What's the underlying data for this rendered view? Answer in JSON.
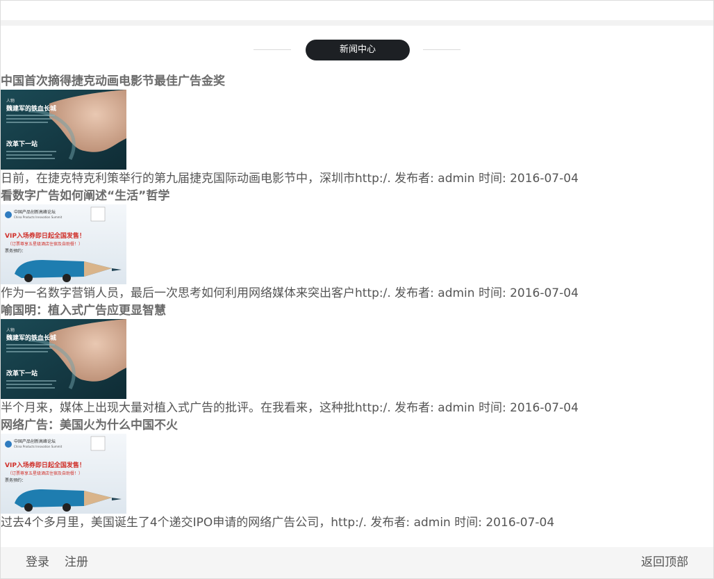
{
  "section": {
    "title": "新闻中心"
  },
  "news": [
    {
      "title": "中国首次摘得捷克动画电影节最佳广告金奖",
      "thumb": "article-cover",
      "thumb_text": {
        "l1": "人物",
        "l2": "魏建军的铁血长城",
        "l3": "改革下一站"
      },
      "desc": "日前，在捷克特克利策举行的第九届捷克国际动画电影节中，深圳市http:/. 发布者: admin 时间: 2016-07-04"
    },
    {
      "title": "看数字广告如何阐述“生活”哲学",
      "thumb": "summit-ad",
      "thumb_text": {
        "l1": "中国产品创新高峰论坛",
        "l2": "China Products Innovation Summit",
        "l3": "VIP入场券即日起全国发售！",
        "l4": "（订票尊享五星级酒店住宿及自助餐！）",
        "l5": "票务预约："
      },
      "desc": "作为一名数字营销人员，最后一次思考如何利用网络媒体来突出客户http:/. 发布者: admin 时间: 2016-07-04"
    },
    {
      "title": "喻国明：植入式广告应更显智慧",
      "thumb": "article-cover",
      "thumb_text": {
        "l1": "人物",
        "l2": "魏建军的铁血长城",
        "l3": "改革下一站"
      },
      "desc": "半个月来，媒体上出现大量对植入式广告的批评。在我看来，这种批http:/. 发布者: admin 时间: 2016-07-04"
    },
    {
      "title": "网络广告：美国火为什么中国不火",
      "thumb": "summit-ad",
      "thumb_text": {
        "l1": "中国产品创新高峰论坛",
        "l2": "China Products Innovation Summit",
        "l3": "VIP入场券即日起全国发售！",
        "l4": "（订票尊享五星级酒店住宿及自助餐！）",
        "l5": "票务预约："
      },
      "desc": "过去4个多月里，美国诞生了4个递交IPO申请的网络广告公司，http:/. 发布者: admin 时间: 2016-07-04"
    }
  ],
  "footer": {
    "login": "登录",
    "register": "注册",
    "back_to_top": "返回顶部"
  },
  "colors": {
    "pill_bg": "#1d2024",
    "strip_bg": "#f2f2f2",
    "footer_bg": "#f5f5f5"
  }
}
